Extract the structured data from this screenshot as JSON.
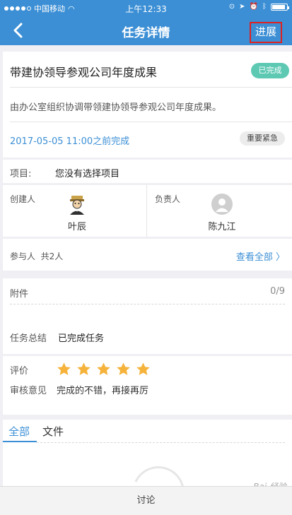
{
  "status_bar": {
    "carrier": "中国移动",
    "time": "上午12:33"
  },
  "nav": {
    "title": "任务详情",
    "progress_label": "进展"
  },
  "task": {
    "title": "带建协领导参观公司年度成果",
    "status": "已完成",
    "description": "由办公室组织协调带领建协领导参观公司年度成果。",
    "due": "2017-05-05 11:00之前完成",
    "priority": "重要紧急"
  },
  "project": {
    "label": "项目:",
    "value": "您没有选择项目"
  },
  "creator": {
    "label": "创建人",
    "name": "叶辰"
  },
  "owner": {
    "label": "负责人",
    "name": "陈九江"
  },
  "participants": {
    "label": "参与人",
    "count": "共2人",
    "view_all": "查看全部 〉"
  },
  "attachments": {
    "label": "附件",
    "count": "0/9"
  },
  "summary": {
    "label": "任务总结",
    "value": "已完成任务"
  },
  "review": {
    "rating_label": "评价",
    "rating": 5,
    "rating_max": 5,
    "opinion_label": "审核意见",
    "opinion": "完成的不错，再接再厉"
  },
  "tabs": [
    {
      "label": "全部"
    },
    {
      "label": "文件"
    }
  ],
  "footer": {
    "discuss_label": "讨论"
  },
  "watermark": "Bai 经验",
  "colors": {
    "primary": "#3c8fd5",
    "done_badge": "#5ec9b3",
    "star": "#f5b33b",
    "highlight": "#e02020"
  }
}
